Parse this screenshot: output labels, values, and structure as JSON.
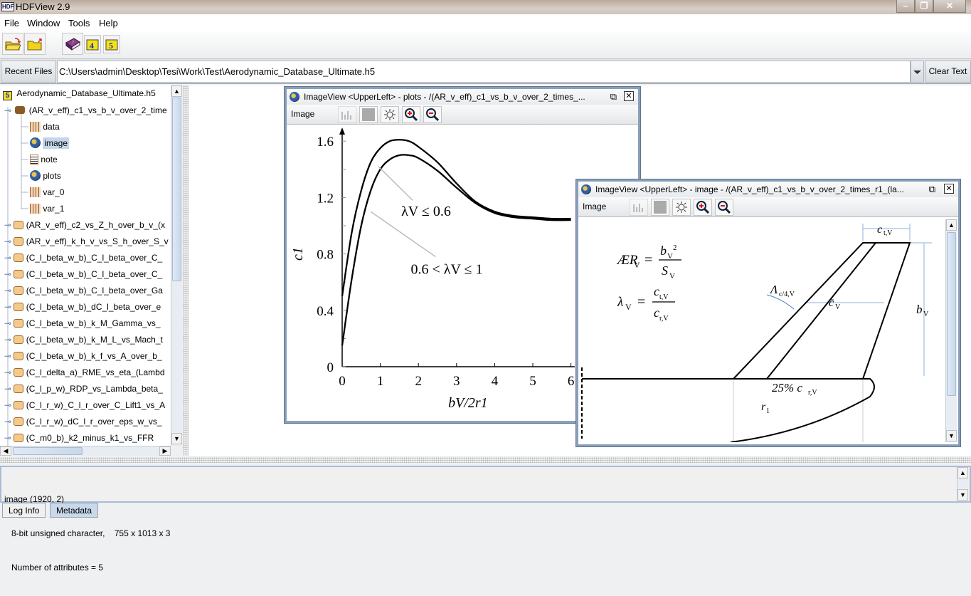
{
  "window": {
    "logo": "HDF",
    "title": "HDFView 2.9",
    "controls": [
      "minimize",
      "restore",
      "close"
    ]
  },
  "menu": [
    {
      "label": "File"
    },
    {
      "label": "Window"
    },
    {
      "label": "Tools"
    },
    {
      "label": "Help"
    }
  ],
  "toolbar": {
    "buttons": [
      "open-file-icon",
      "close-file-icon",
      "help-book-icon",
      "hdf4-library-icon",
      "hdf5-library-icon"
    ],
    "hdf4_label": "4",
    "hdf5_label": "5"
  },
  "pathbar": {
    "recent_label": "Recent Files",
    "path": "C:\\Users\\admin\\Desktop\\Tesi\\Work\\Test\\Aerodynamic_Database_Ultimate.h5",
    "clear_label": "Clear Text"
  },
  "tree": {
    "root": "Aerodynamic_Database_Ultimate.h5",
    "expanded_group": "(AR_v_eff)_c1_vs_b_v_over_2_time",
    "children": [
      {
        "label": "data",
        "icon": "dataset-icon"
      },
      {
        "label": "image",
        "icon": "image-icon",
        "selected": true
      },
      {
        "label": "note",
        "icon": "text-icon"
      },
      {
        "label": "plots",
        "icon": "image-icon"
      },
      {
        "label": "var_0",
        "icon": "dataset-icon"
      },
      {
        "label": "var_1",
        "icon": "dataset-icon"
      }
    ],
    "groups": [
      "(AR_v_eff)_c2_vs_Z_h_over_b_v_(x",
      "(AR_v_eff)_k_h_v_vs_S_h_over_S_v",
      "(C_l_beta_w_b)_C_l_beta_over_C_",
      "(C_l_beta_w_b)_C_l_beta_over_C_",
      "(C_l_beta_w_b)_C_l_beta_over_Ga",
      "(C_l_beta_w_b)_dC_l_beta_over_e",
      "(C_l_beta_w_b)_k_M_Gamma_vs_",
      "(C_l_beta_w_b)_k_M_L_vs_Mach_t",
      "(C_l_beta_w_b)_k_f_vs_A_over_b_",
      "(C_l_delta_a)_RME_vs_eta_(Lambd",
      "(C_l_p_w)_RDP_vs_Lambda_beta_",
      "(C_l_r_w)_C_l_r_over_C_Lift1_vs_A",
      "(C_l_r_w)_dC_l_r_over_eps_w_vs_",
      "(C_m0_b)_k2_minus_k1_vs_FFR"
    ]
  },
  "plots_window": {
    "title": "ImageView <UpperLeft>  -  plots  -  /(AR_v_eff)_c1_vs_b_v_over_2_times_...",
    "menu_label": "Image",
    "tools": [
      "histogram-icon",
      "palette-icon",
      "brightness-icon",
      "zoom-in-icon",
      "zoom-out-icon"
    ]
  },
  "image_window": {
    "title": "ImageView <UpperLeft>  -  image  -  /(AR_v_eff)_c1_vs_b_v_over_2_times_r1_(la...",
    "menu_label": "Image",
    "tools": [
      "histogram-icon",
      "palette-icon",
      "brightness-icon",
      "zoom-in-icon",
      "zoom-out-icon"
    ],
    "formula_ar_lhs": "ÆR",
    "formula_ar_num": "b",
    "formula_ar_den": "S",
    "formula_lambda_lhs": "λ",
    "formula_lambda_num": "c",
    "formula_lambda_den": "c",
    "sub_v": "V",
    "sub_tv": "t,V",
    "sub_rv": "r,V",
    "label_ct": "c",
    "label_sweep": "Λ",
    "sub_sweep": "c/4,V",
    "label_cbar": "c̄",
    "label_bv": "b",
    "label_root": "25% c",
    "label_r1": "r",
    "sub_1": "1"
  },
  "chart_data": {
    "type": "line",
    "title": "",
    "xlabel": "bV/2r1",
    "ylabel": "c1",
    "xlim": [
      0,
      6
    ],
    "ylim": [
      0,
      1.6
    ],
    "xticks": [
      "0",
      "1",
      "2",
      "3",
      "4",
      "5",
      "6"
    ],
    "yticks": [
      "0",
      "0.4",
      "0.8",
      "1.2",
      "1.6"
    ],
    "grid": false,
    "x": [
      0,
      0.25,
      0.5,
      0.75,
      1.0,
      1.25,
      1.5,
      1.75,
      2.0,
      2.5,
      3.0,
      3.5,
      4.0,
      4.5,
      5.0,
      5.5,
      6.0
    ],
    "series": [
      {
        "name": "λV ≤ 0.6",
        "values": [
          0.5,
          0.95,
          1.25,
          1.45,
          1.55,
          1.6,
          1.61,
          1.6,
          1.56,
          1.45,
          1.3,
          1.17,
          1.1,
          1.07,
          1.06,
          1.05,
          1.05
        ]
      },
      {
        "name": "0.6 < λV ≤ 1",
        "values": [
          0.15,
          0.62,
          1.0,
          1.25,
          1.4,
          1.47,
          1.5,
          1.5,
          1.48,
          1.39,
          1.27,
          1.16,
          1.09,
          1.06,
          1.05,
          1.04,
          1.04
        ]
      }
    ],
    "annotations": [
      {
        "text": "λV ≤ 0.6",
        "points_to": "upper curve"
      },
      {
        "text": "0.6 < λV ≤ 1",
        "points_to": "lower curve"
      }
    ]
  },
  "info": {
    "lines": [
      "image (1920, 2)",
      "   8-bit unsigned character,    755 x 1013 x 3",
      "   Number of attributes = 5"
    ]
  },
  "tabs": [
    {
      "label": "Log Info"
    },
    {
      "label": "Metadata",
      "active": true
    }
  ]
}
